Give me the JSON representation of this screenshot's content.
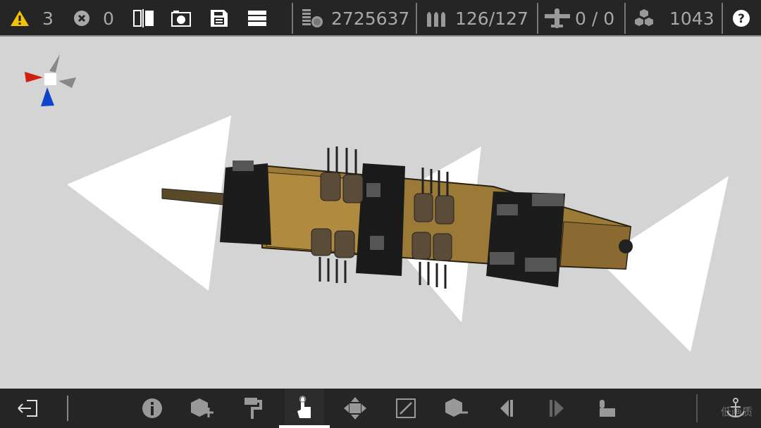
{
  "topbar": {
    "warnings": "3",
    "errors": "0",
    "cost": "2725637",
    "weapons": "126/127",
    "aircraft": "0 / 0",
    "blocks": "1043",
    "icons": [
      "warning-icon",
      "error-icon",
      "split-view-icon",
      "camera-icon",
      "save-icon",
      "menu-icon",
      "cost-icon",
      "ammo-icon",
      "aircraft-icon",
      "blocks-icon",
      "help-icon"
    ]
  },
  "bottombar": {
    "icons": [
      "exit-icon",
      "info-icon",
      "add-block-icon",
      "paint-roller-icon",
      "select-hand-icon",
      "move-icon",
      "resize-icon",
      "remove-block-icon",
      "previous-icon",
      "next-icon",
      "build-icon",
      "anchor-icon"
    ],
    "watermark": "低画质"
  },
  "colors": {
    "bar": "#252525",
    "viewport": "#d4d4d4",
    "hull": "#7a5c20",
    "active_underline": "#ffffff",
    "warning": "#f5c400"
  }
}
